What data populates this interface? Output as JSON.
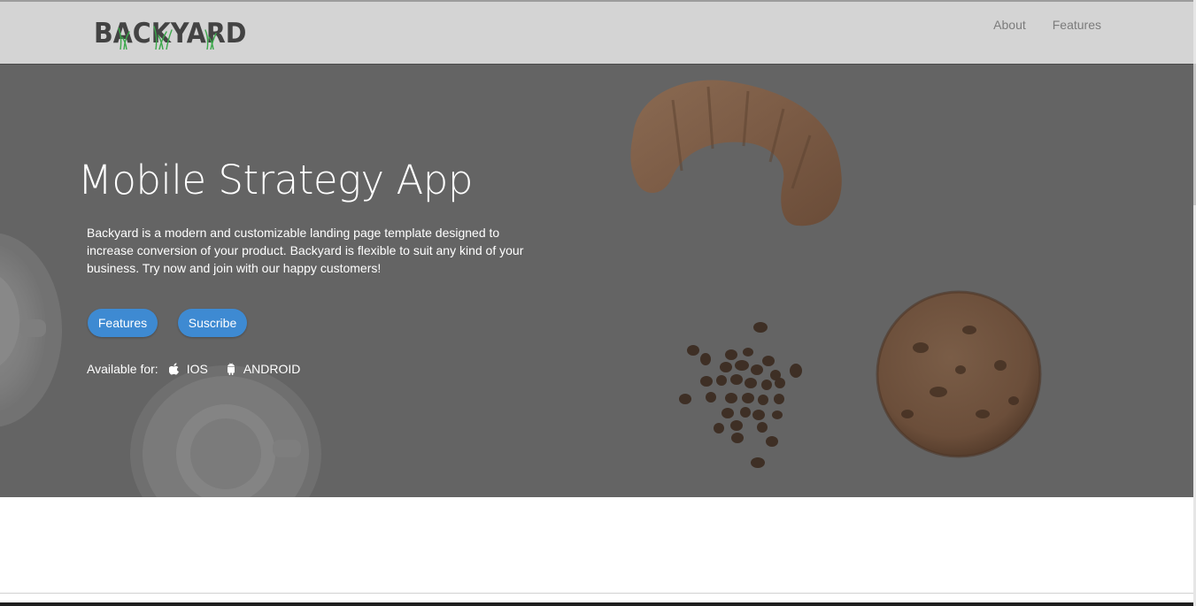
{
  "navbar": {
    "logo_text": "BACKYARD",
    "links": [
      {
        "label": "About"
      },
      {
        "label": "Features"
      }
    ]
  },
  "hero": {
    "title": "Mobile Strategy App",
    "description": "Backyard is a modern and customizable landing page template designed to increase conversion of your product. Backyard is flexible to suit any kind of your business. Try now and join with our happy customers!",
    "buttons": {
      "features_label": "Features",
      "subscribe_label": "Suscribe"
    },
    "available": {
      "label": "Available for:",
      "platforms": [
        {
          "name": "IOS",
          "icon": "apple-icon"
        },
        {
          "name": "ANDROID",
          "icon": "android-icon"
        }
      ]
    }
  },
  "colors": {
    "navbar_bg": "#d4d4d4",
    "hero_overlay": "#646464",
    "button_accent": "#3e8ad2",
    "logo_green": "#3aa84a"
  }
}
